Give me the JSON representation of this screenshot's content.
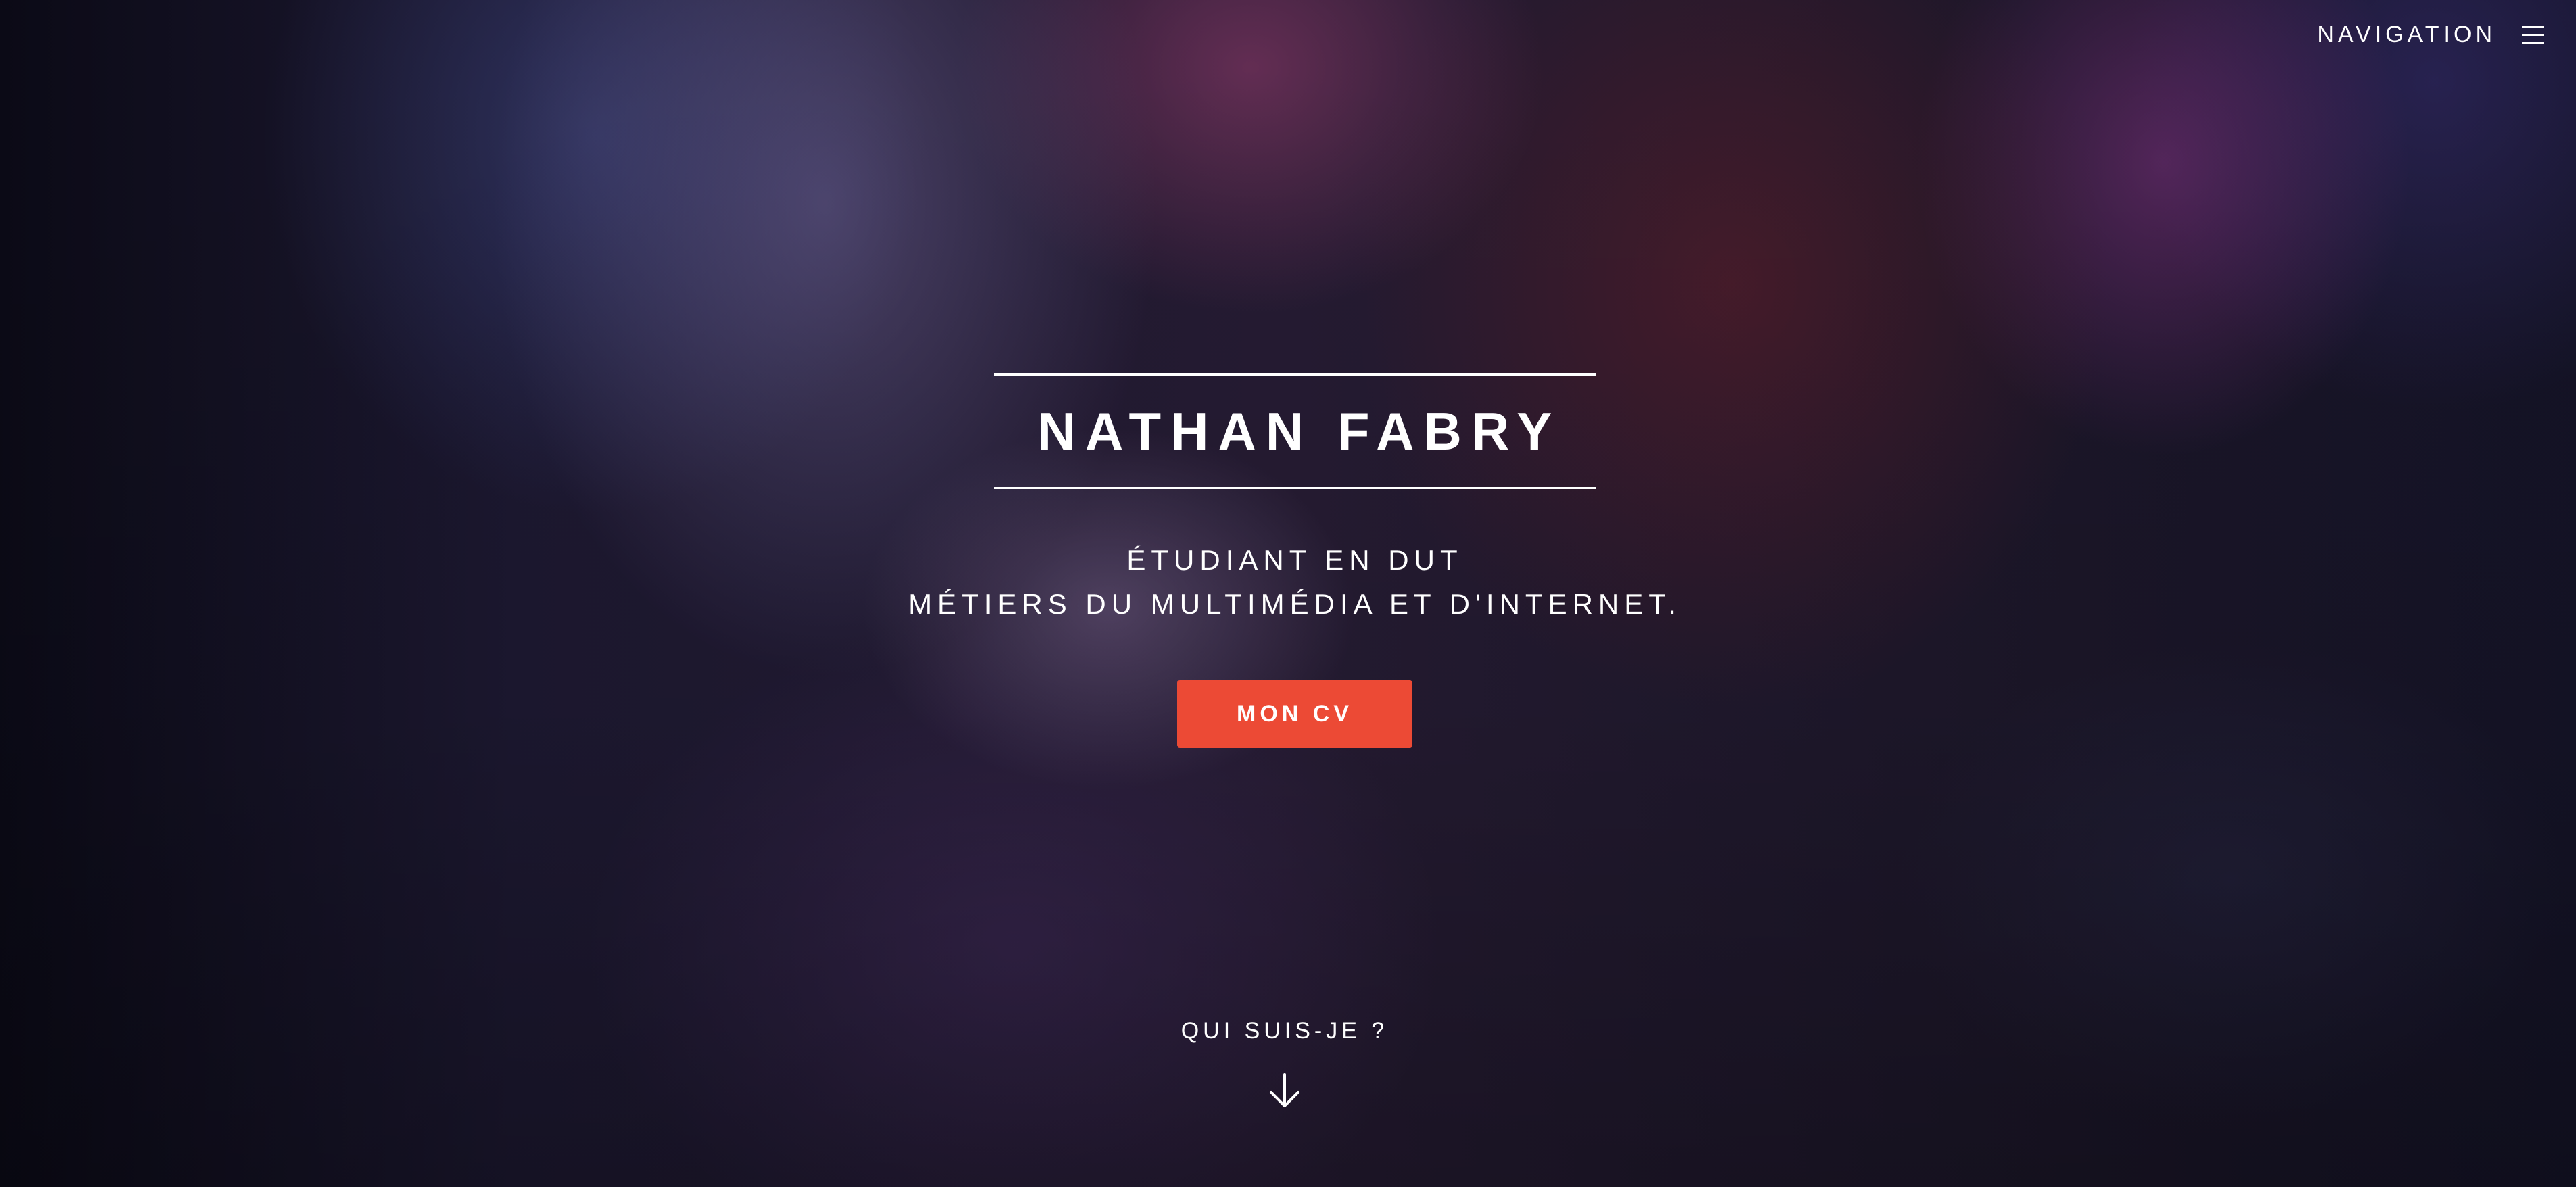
{
  "nav": {
    "label": "NAVIGATION",
    "menu_icon": "hamburger-menu-icon"
  },
  "hero": {
    "name": "NATHAN FABRY",
    "subtitle_line1": "ÉTUDIANT EN DUT",
    "subtitle_line2": "MÉTIERS DU MULTIMÉDIA ET D'INTERNET.",
    "cv_button_label": "MON CV",
    "scroll_label": "QUI SUIS-JE ?",
    "scroll_icon": "arrow-down-icon"
  },
  "colors": {
    "accent": "#ec4a35",
    "text": "#ffffff"
  }
}
